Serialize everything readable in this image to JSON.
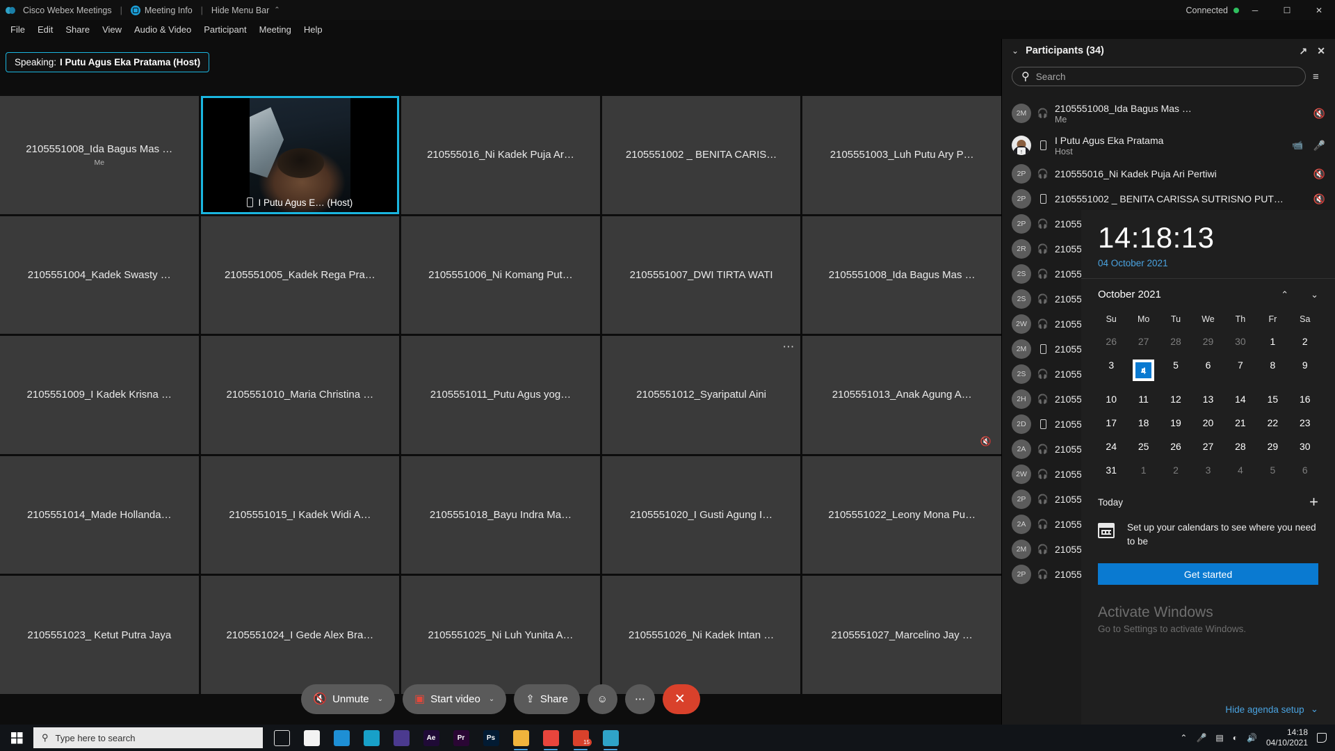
{
  "titlebar": {
    "app_name": "Cisco Webex Meetings",
    "separator": "|",
    "meeting_info": "Meeting Info",
    "separator2": "|",
    "hide_menu_bar": "Hide Menu Bar",
    "caret": "⌃",
    "connected": "Connected",
    "minimize": "─",
    "maximize": "☐",
    "close": "✕"
  },
  "menubar": {
    "items": [
      "File",
      "Edit",
      "Share",
      "View",
      "Audio & Video",
      "Participant",
      "Meeting",
      "Help"
    ]
  },
  "speaking_badge": {
    "prefix": "Speaking:",
    "name": "I Putu Agus Eka Pratama (Host)"
  },
  "grid": {
    "tiles": [
      {
        "name": "2105551008_Ida Bagus Mas …",
        "sub": "Me",
        "active": false
      },
      {
        "name": "I Putu Agus E…  (Host)",
        "sub": "",
        "active": true,
        "has_video": true,
        "device": "phone"
      },
      {
        "name": "210555016_Ni Kadek Puja Ar…",
        "sub": "",
        "active": false
      },
      {
        "name": "2105551002 _ BENITA CARIS…",
        "sub": "",
        "active": false
      },
      {
        "name": "2105551003_Luh Putu Ary P…",
        "sub": "",
        "active": false
      },
      {
        "name": "2105551004_Kadek Swasty …",
        "sub": "",
        "active": false
      },
      {
        "name": "2105551005_Kadek Rega Pra…",
        "sub": "",
        "active": false
      },
      {
        "name": "2105551006_Ni Komang Put…",
        "sub": "",
        "active": false
      },
      {
        "name": "2105551007_DWI TIRTA WATI",
        "sub": "",
        "active": false
      },
      {
        "name": "2105551008_Ida Bagus Mas …",
        "sub": "",
        "active": false
      },
      {
        "name": "2105551009_I Kadek Krisna …",
        "sub": "",
        "active": false
      },
      {
        "name": "2105551010_Maria Christina …",
        "sub": "",
        "active": false
      },
      {
        "name": "2105551011_Putu Agus yog…",
        "sub": "",
        "active": false
      },
      {
        "name": "2105551012_Syaripatul Aini",
        "sub": "",
        "active": false,
        "more": true
      },
      {
        "name": "2105551013_Anak Agung A…",
        "sub": "",
        "active": false,
        "muted": true
      },
      {
        "name": "2105551014_Made Hollanda…",
        "sub": "",
        "active": false
      },
      {
        "name": "2105551015_I Kadek Widi A…",
        "sub": "",
        "active": false
      },
      {
        "name": "2105551018_Bayu Indra Ma…",
        "sub": "",
        "active": false
      },
      {
        "name": "2105551020_I Gusti Agung I…",
        "sub": "",
        "active": false
      },
      {
        "name": "2105551022_Leony Mona Pu…",
        "sub": "",
        "active": false
      },
      {
        "name": "2105551023_ Ketut Putra Jaya",
        "sub": "",
        "active": false
      },
      {
        "name": "2105551024_I Gede Alex Bra…",
        "sub": "",
        "active": false
      },
      {
        "name": "2105551025_Ni Luh Yunita A…",
        "sub": "",
        "active": false
      },
      {
        "name": "2105551026_Ni Kadek Intan …",
        "sub": "",
        "active": false
      },
      {
        "name": "2105551027_Marcelino Jay …",
        "sub": "",
        "active": false
      }
    ]
  },
  "controls": {
    "unmute": "Unmute",
    "start_video": "Start video",
    "share": "Share",
    "reactions_icon": "smiley-plus-icon",
    "more_icon": "ellipsis-icon",
    "end_icon": "✕",
    "chevron": "⌄"
  },
  "participants_panel": {
    "title": "Participants (34)",
    "collapse_icon": "⌄",
    "popout_icon": "↗",
    "close_icon": "✕",
    "search_placeholder": "Search",
    "search_value": "",
    "sort_icon": "sort-icon",
    "list": [
      {
        "initials": "2M",
        "name": "2105551008_Ida Bagus Mas …",
        "role": "Me",
        "device": "headset",
        "mic": "muted"
      },
      {
        "initials": "",
        "photo": true,
        "name": "I Putu Agus Eka Pratama",
        "role": "Host",
        "device": "phone",
        "mic": "active",
        "camera": true
      },
      {
        "initials": "2P",
        "name": "210555016_Ni Kadek Puja Ari Pertiwi",
        "role": "",
        "device": "headset",
        "mic": "muted"
      },
      {
        "initials": "2P",
        "name": "2105551002 _ BENITA CARISSA SUTRISNO PUT…",
        "role": "",
        "device": "phone",
        "mic": "muted"
      },
      {
        "initials": "2P",
        "name": "21055",
        "role": "",
        "device": "headset",
        "mic": ""
      },
      {
        "initials": "2R",
        "name": "21055",
        "role": "",
        "device": "headset",
        "mic": ""
      },
      {
        "initials": "2S",
        "name": "21055",
        "role": "",
        "device": "headset",
        "mic": ""
      },
      {
        "initials": "2S",
        "name": "21055",
        "role": "",
        "device": "headset",
        "mic": ""
      },
      {
        "initials": "2W",
        "name": "21055",
        "role": "",
        "device": "headset",
        "mic": ""
      },
      {
        "initials": "2M",
        "name": "21055",
        "role": "",
        "device": "phone",
        "mic": ""
      },
      {
        "initials": "2S",
        "name": "21055",
        "role": "",
        "device": "headset",
        "mic": ""
      },
      {
        "initials": "2H",
        "name": "21055",
        "role": "",
        "device": "headset",
        "mic": ""
      },
      {
        "initials": "2D",
        "name": "21055",
        "role": "",
        "device": "phone",
        "mic": ""
      },
      {
        "initials": "2A",
        "name": "21055",
        "role": "",
        "device": "headset",
        "mic": ""
      },
      {
        "initials": "2W",
        "name": "21055",
        "role": "",
        "device": "headset",
        "mic": ""
      },
      {
        "initials": "2P",
        "name": "21055",
        "role": "",
        "device": "headset",
        "mic": ""
      },
      {
        "initials": "2A",
        "name": "21055",
        "role": "",
        "device": "headset",
        "mic": ""
      },
      {
        "initials": "2M",
        "name": "21055",
        "role": "",
        "device": "headset",
        "mic": ""
      },
      {
        "initials": "2P",
        "name": "21055",
        "role": "",
        "device": "headset",
        "mic": ""
      }
    ]
  },
  "clock_flyout": {
    "time": "14:18:13",
    "date": "04 October 2021",
    "month_title": "October 2021",
    "prev_icon": "⌃",
    "next_icon": "⌄",
    "day_headers": [
      "Su",
      "Mo",
      "Tu",
      "We",
      "Th",
      "Fr",
      "Sa"
    ],
    "weeks": [
      [
        {
          "d": "26",
          "muted": true
        },
        {
          "d": "27",
          "muted": true
        },
        {
          "d": "28",
          "muted": true
        },
        {
          "d": "29",
          "muted": true
        },
        {
          "d": "30",
          "muted": true
        },
        {
          "d": "1"
        },
        {
          "d": "2"
        }
      ],
      [
        {
          "d": "3"
        },
        {
          "d": "4",
          "selected": true
        },
        {
          "d": "5"
        },
        {
          "d": "6"
        },
        {
          "d": "7"
        },
        {
          "d": "8"
        },
        {
          "d": "9"
        }
      ],
      [
        {
          "d": "10"
        },
        {
          "d": "11"
        },
        {
          "d": "12"
        },
        {
          "d": "13"
        },
        {
          "d": "14"
        },
        {
          "d": "15"
        },
        {
          "d": "16"
        }
      ],
      [
        {
          "d": "17"
        },
        {
          "d": "18"
        },
        {
          "d": "19"
        },
        {
          "d": "20"
        },
        {
          "d": "21"
        },
        {
          "d": "22"
        },
        {
          "d": "23"
        }
      ],
      [
        {
          "d": "24"
        },
        {
          "d": "25"
        },
        {
          "d": "26"
        },
        {
          "d": "27"
        },
        {
          "d": "28"
        },
        {
          "d": "29"
        },
        {
          "d": "30"
        }
      ],
      [
        {
          "d": "31"
        },
        {
          "d": "1",
          "muted": true
        },
        {
          "d": "2",
          "muted": true
        },
        {
          "d": "3",
          "muted": true
        },
        {
          "d": "4",
          "muted": true
        },
        {
          "d": "5",
          "muted": true
        },
        {
          "d": "6",
          "muted": true
        }
      ]
    ],
    "today_label": "Today",
    "add_icon": "+",
    "agenda_text": "Set up your calendars to see where you need to be",
    "get_started": "Get started",
    "activate_title": "Activate Windows",
    "activate_sub": "Go to Settings to activate Windows.",
    "hide_agenda": "Hide agenda setup",
    "hide_agenda_chevron": "⌄"
  },
  "taskbar": {
    "search_placeholder": "Type here to search",
    "search_icon": "search-icon",
    "start_icon": "windows-start-icon",
    "apps": [
      {
        "name": "task-view-icon",
        "label": "",
        "color": "transparent"
      },
      {
        "name": "microsoft-store-icon",
        "label": "",
        "color": "#f3f3f3"
      },
      {
        "name": "mail-icon",
        "label": "",
        "color": "#1e8fd5"
      },
      {
        "name": "edge-icon",
        "label": "",
        "color": "#18a0c8"
      },
      {
        "name": "app-purple-icon",
        "label": "",
        "color": "#4b3a8f"
      },
      {
        "name": "after-effects-icon",
        "label": "Ae",
        "color": "#1f0a36"
      },
      {
        "name": "premiere-pro-icon",
        "label": "Pr",
        "color": "#2a0634"
      },
      {
        "name": "photoshop-icon",
        "label": "Ps",
        "color": "#021b33"
      },
      {
        "name": "file-explorer-icon",
        "label": "",
        "color": "#f0b43c"
      },
      {
        "name": "chrome-icon",
        "label": "",
        "color": "#e8453c"
      },
      {
        "name": "telegram-icon",
        "label": "",
        "color": "#d9412b",
        "badge": "15"
      },
      {
        "name": "webex-icon",
        "label": "",
        "color": "#2fa3c8"
      }
    ],
    "tray": {
      "chevron_up": "⌃",
      "mic_icon": "mic-icon",
      "battery_icon": "battery-icon",
      "wifi_icon": "wifi-icon",
      "volume_icon": "volume-icon",
      "time": "14:18",
      "date": "04/10/2021",
      "notification_icon": "notification-icon"
    }
  }
}
